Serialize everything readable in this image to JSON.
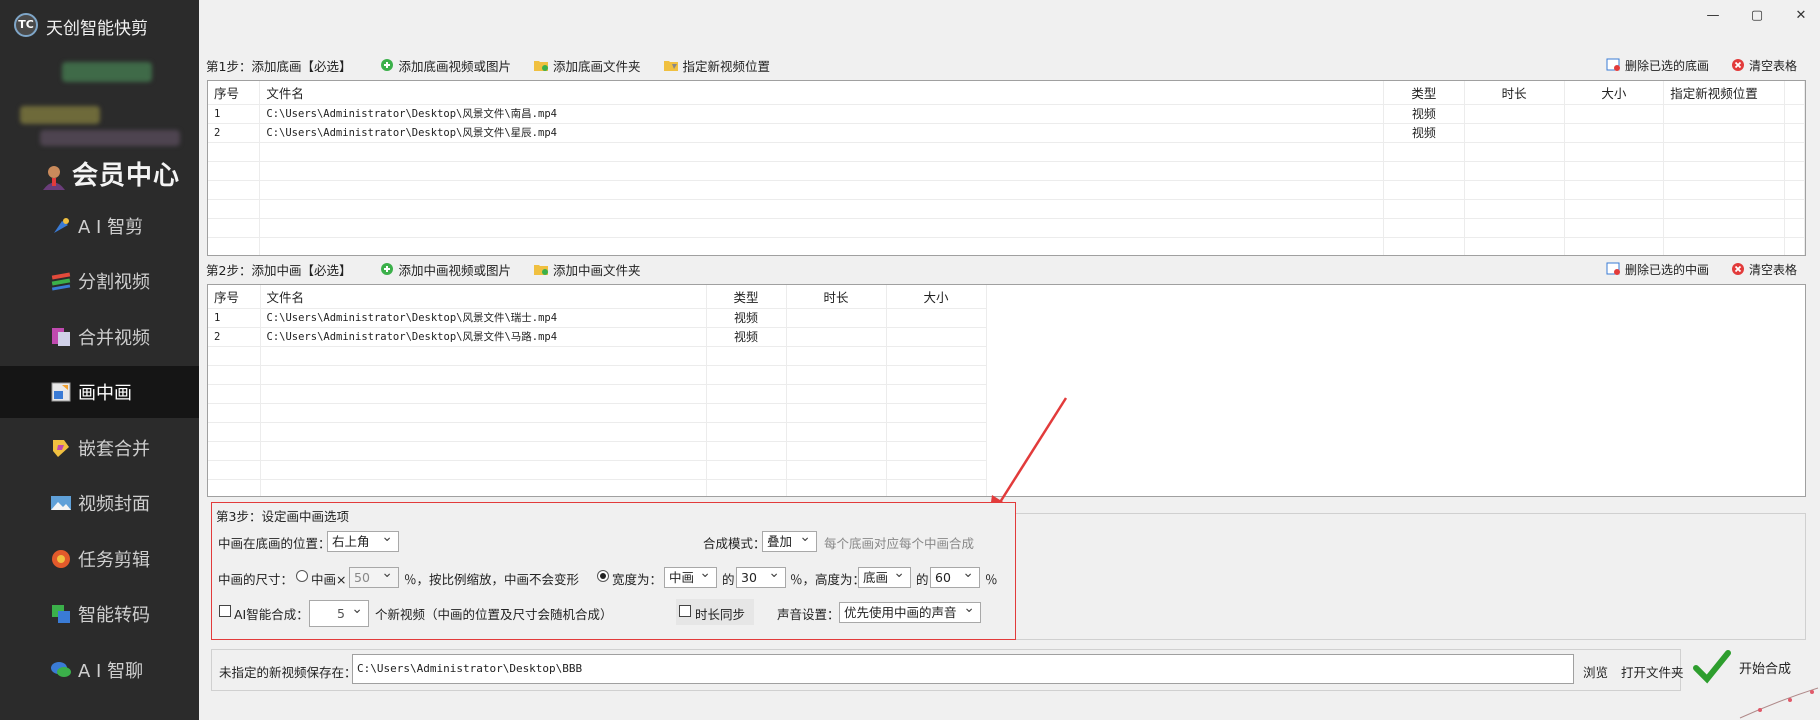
{
  "app": {
    "title": "天创智能快剪"
  },
  "window": {
    "minimize": "—",
    "maximize": "▢",
    "close": "✕"
  },
  "sidebar": {
    "member": "会员中心",
    "items": [
      {
        "label": "A I 智剪",
        "icon": "ai-clip-icon"
      },
      {
        "label": "分割视频",
        "icon": "split-video-icon"
      },
      {
        "label": "合并视频",
        "icon": "merge-video-icon"
      },
      {
        "label": "画中画",
        "icon": "pip-icon",
        "active": true
      },
      {
        "label": "嵌套合并",
        "icon": "nested-merge-icon"
      },
      {
        "label": "视频封面",
        "icon": "video-cover-icon"
      },
      {
        "label": "任务剪辑",
        "icon": "task-edit-icon"
      },
      {
        "label": "智能转码",
        "icon": "transcode-icon"
      },
      {
        "label": "A I 智聊",
        "icon": "ai-chat-icon"
      }
    ]
  },
  "step1": {
    "title": "第1步：添加底画【必选】",
    "add_media": "添加底画视频或图片",
    "add_folder": "添加底画文件夹",
    "set_location": "指定新视频位置",
    "delete_selected": "删除已选的底画",
    "clear_table": "清空表格",
    "columns": [
      "序号",
      "文件名",
      "类型",
      "时长",
      "大小",
      "指定新视频位置"
    ],
    "rows": [
      [
        "1",
        "C:\\Users\\Administrator\\Desktop\\风景文件\\南昌.mp4",
        "视频",
        "",
        "",
        ""
      ],
      [
        "2",
        "C:\\Users\\Administrator\\Desktop\\风景文件\\星辰.mp4",
        "视频",
        "",
        "",
        ""
      ]
    ]
  },
  "step2": {
    "title": "第2步：添加中画【必选】",
    "add_media": "添加中画视频或图片",
    "add_folder": "添加中画文件夹",
    "delete_selected": "删除已选的中画",
    "clear_table": "清空表格",
    "columns": [
      "序号",
      "文件名",
      "类型",
      "时长",
      "大小"
    ],
    "rows": [
      [
        "1",
        "C:\\Users\\Administrator\\Desktop\\风景文件\\瑞士.mp4",
        "视频",
        "",
        ""
      ],
      [
        "2",
        "C:\\Users\\Administrator\\Desktop\\风景文件\\马路.mp4",
        "视频",
        "",
        ""
      ]
    ]
  },
  "step3": {
    "title": "第3步：设定画中画选项",
    "position_label": "中画在底画的位置：",
    "position_value": "右上角",
    "blend_label": "合成模式：",
    "blend_value": "叠加",
    "blend_hint": "每个底画对应每个中画合成",
    "size_label": "中画的尺寸：",
    "scale_option": "中画×",
    "scale_value": "50",
    "scale_hint": "％，按比例缩放，中画不会变形",
    "width_label": "宽度为：",
    "width_ref": "中画",
    "of1": "的",
    "width_value": "30",
    "height_label": "％，高度为：",
    "height_ref": "底画",
    "of2": "的",
    "height_value": "60",
    "percent": "％",
    "ai_label": "AI智能合成：",
    "ai_count": "5",
    "ai_hint": "个新视频（中画的位置及尺寸会随机合成）",
    "sync_label": "时长同步",
    "audio_label": "声音设置：",
    "audio_value": "优先使用中画的声音"
  },
  "output": {
    "label": "未指定的新视频保存在：",
    "path": "C:\\Users\\Administrator\\Desktop\\BBB",
    "browse": "浏览",
    "open_folder": "打开文件夹",
    "start": "开始合成"
  },
  "colors": {
    "sidebar_bg": "#2b2b2b",
    "highlight": "#e23b3b",
    "accent_green": "#2e9e2e"
  }
}
